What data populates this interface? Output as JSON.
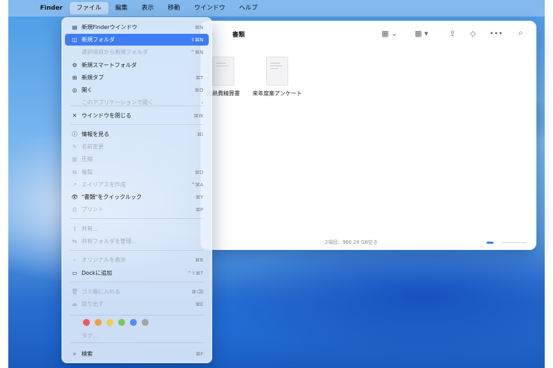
{
  "menubar": {
    "apple": "",
    "items": [
      "Finder",
      "ファイル",
      "編集",
      "表示",
      "移動",
      "ウインドウ",
      "ヘルプ"
    ]
  },
  "finder": {
    "forward": "›",
    "title": "書類",
    "files": [
      {
        "name": "光熱費精算書"
      },
      {
        "name": "来年度案アンケート"
      }
    ],
    "status": "2項目、966.28 GB空き"
  },
  "menu": {
    "items": [
      {
        "label": "新規Finderウインドウ",
        "shortcut": "⌘N",
        "icon": "▤",
        "disabled": false,
        "selected": false
      },
      {
        "label": "新規フォルダ",
        "shortcut": "⇧⌘N",
        "icon": "◫",
        "disabled": false,
        "selected": true
      },
      {
        "label": "選択項目から新規フォルダ",
        "shortcut": "^⌘N",
        "icon": "",
        "disabled": true,
        "selected": false
      },
      {
        "label": "新規スマートフォルダ",
        "shortcut": "",
        "icon": "⚙",
        "disabled": false,
        "selected": false
      },
      {
        "label": "新規タブ",
        "shortcut": "⌘T",
        "icon": "⊞",
        "disabled": false,
        "selected": false
      },
      {
        "label": "開く",
        "shortcut": "⌘O",
        "icon": "◎",
        "disabled": false,
        "selected": false
      },
      {
        "label": "このアプリケーションで開く",
        "shortcut": "›",
        "icon": "",
        "disabled": true,
        "selected": false
      },
      {
        "label": "ウインドウを閉じる",
        "shortcut": "⌘W",
        "icon": "✕",
        "disabled": false,
        "selected": false
      },
      {
        "label": "情報を見る",
        "shortcut": "⌘I",
        "icon": "ⓘ",
        "disabled": false,
        "selected": false
      },
      {
        "label": "名前変更",
        "shortcut": "",
        "icon": "✎",
        "disabled": true,
        "selected": false
      },
      {
        "label": "圧縮",
        "shortcut": "",
        "icon": "▥",
        "disabled": true,
        "selected": false
      },
      {
        "label": "複製",
        "shortcut": "⌘D",
        "icon": "⧉",
        "disabled": true,
        "selected": false
      },
      {
        "label": "エイリアスを作成",
        "shortcut": "^⌘A",
        "icon": "↗",
        "disabled": true,
        "selected": false
      },
      {
        "label": "\"書類\"をクイックルック",
        "shortcut": "⌘Y",
        "icon": "👁",
        "disabled": false,
        "selected": false
      },
      {
        "label": "プリント",
        "shortcut": "⌘P",
        "icon": "⎙",
        "disabled": true,
        "selected": false
      },
      {
        "label": "共有...",
        "shortcut": "",
        "icon": "⇪",
        "disabled": true,
        "selected": false
      },
      {
        "label": "共有フォルダを管理...",
        "shortcut": "",
        "icon": "⇆",
        "disabled": true,
        "selected": false
      },
      {
        "label": "オリジナルを表示",
        "shortcut": "⌘R",
        "icon": "⌕",
        "disabled": true,
        "selected": false
      },
      {
        "label": "Dockに追加",
        "shortcut": "^⇧⌘T",
        "icon": "▭",
        "disabled": false,
        "selected": false
      },
      {
        "label": "ゴミ箱に入れる",
        "shortcut": "⌘⌫",
        "icon": "🗑",
        "disabled": true,
        "selected": false
      },
      {
        "label": "取り出す",
        "shortcut": "⌘E",
        "icon": "⏏",
        "disabled": true,
        "selected": false
      },
      {
        "label": "タグ...",
        "shortcut": "",
        "icon": "",
        "disabled": true,
        "selected": false
      },
      {
        "label": "検索",
        "shortcut": "⌘F",
        "icon": "⌕",
        "disabled": false,
        "selected": false
      }
    ],
    "tag_colors": [
      "#f05a5a",
      "#f39a4a",
      "#f2cf4a",
      "#79c75a",
      "#4f8ff2",
      "#a3a3a8"
    ]
  },
  "colors": {
    "accent": "#3d7cf2"
  }
}
